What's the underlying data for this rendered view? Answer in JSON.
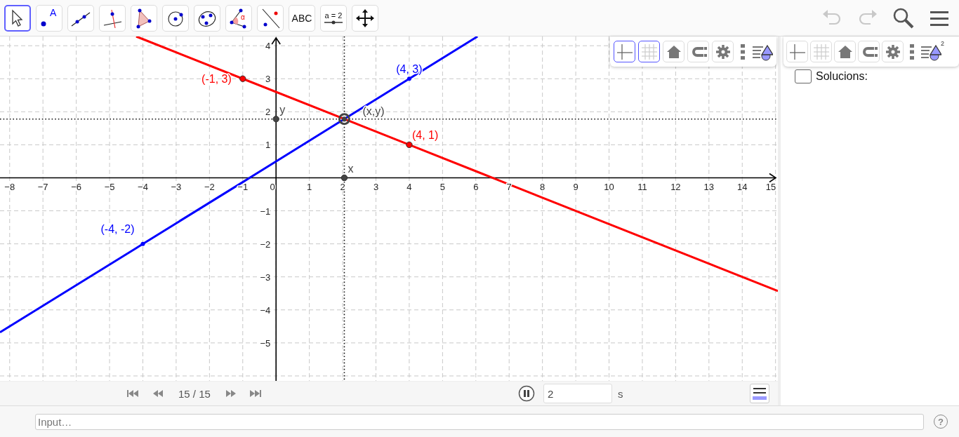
{
  "toolbar": {
    "tools": [
      {
        "kind": "move",
        "selected": true
      },
      {
        "kind": "point",
        "label": "A",
        "selected": false
      },
      {
        "kind": "line",
        "selected": false
      },
      {
        "kind": "perpendicular",
        "selected": false
      },
      {
        "kind": "polygon",
        "selected": false
      },
      {
        "kind": "circle",
        "selected": false
      },
      {
        "kind": "conic",
        "selected": false
      },
      {
        "kind": "angle",
        "label": "α",
        "selected": false
      },
      {
        "kind": "reflect",
        "selected": false
      },
      {
        "kind": "text",
        "label": "ABC",
        "selected": false
      },
      {
        "kind": "slider",
        "label": "a = 2",
        "selected": false
      },
      {
        "kind": "move-view",
        "selected": false
      }
    ],
    "actions": [
      {
        "kind": "undo",
        "disabled": true
      },
      {
        "kind": "redo",
        "disabled": true
      },
      {
        "kind": "search",
        "disabled": false
      },
      {
        "kind": "menu",
        "disabled": false
      }
    ]
  },
  "graphics_view": {
    "style_bar": {
      "buttons": [
        {
          "kind": "axes",
          "selected": true
        },
        {
          "kind": "grid",
          "selected": true
        },
        {
          "kind": "home",
          "selected": false
        },
        {
          "kind": "snap",
          "selected": false
        },
        {
          "kind": "settings",
          "selected": false
        },
        {
          "kind": "more"
        },
        {
          "kind": "view-menu"
        }
      ]
    },
    "chart_data": {
      "type": "line",
      "x": [
        -8.29,
        -4.2,
        -4,
        -1,
        4,
        6.05,
        15.07
      ],
      "grid": true,
      "series": [
        {
          "color": "#0000ff",
          "values": [
            -4.68,
            -2.13,
            -2,
            -0.13,
            3,
            4.28,
            null
          ]
        },
        {
          "color": "#ff0000",
          "values": [
            null,
            4.28,
            4.2,
            3,
            1,
            0.18,
            -3.43
          ]
        }
      ],
      "ref_lines": [
        {
          "axis": "x",
          "value": 2.05
        },
        {
          "axis": "y",
          "value": 1.78
        }
      ],
      "xlim": [
        -8.29,
        15.07
      ],
      "ylim": [
        -6.15,
        4.28
      ],
      "xticks": [
        {
          "value": -8,
          "label": "−8"
        },
        {
          "value": -7,
          "label": "−7"
        },
        {
          "value": -6,
          "label": "−6"
        },
        {
          "value": -5,
          "label": "−5"
        },
        {
          "value": -4,
          "label": "−4"
        },
        {
          "value": -3,
          "label": "−3"
        },
        {
          "value": -2,
          "label": "−2"
        },
        {
          "value": -1,
          "label": "−1"
        },
        0,
        1,
        2,
        3,
        4,
        5,
        6,
        7,
        8,
        9,
        10,
        11,
        12,
        13,
        14,
        15
      ],
      "yticks": [
        {
          "value": -5,
          "label": "−5"
        },
        {
          "value": -4,
          "label": "−4"
        },
        {
          "value": -3,
          "label": "−3"
        },
        {
          "value": -2,
          "label": "−2"
        },
        {
          "value": -1,
          "label": "−1"
        },
        1,
        2,
        3,
        4
      ],
      "annotations": [
        {
          "x": -4,
          "y": -2,
          "text": "(-4, -2)"
        },
        {
          "x": 4,
          "y": 3,
          "text": "(4, 3)"
        },
        {
          "x": -1,
          "y": 3,
          "text": "(-1, 3)"
        },
        {
          "x": 4,
          "y": 1,
          "text": "(4, 1)"
        },
        {
          "x": 2.05,
          "y": 1.78,
          "text": "(x,y)"
        },
        {
          "x": 2.05,
          "y": 0,
          "text": "x"
        },
        {
          "x": 0,
          "y": 1.78,
          "text": "y"
        }
      ]
    }
  },
  "playback": {
    "frame": "15 / 15",
    "playing": true,
    "speed": "2",
    "unit": "s"
  },
  "side_view": {
    "style_bar": {
      "buttons": [
        {
          "kind": "axes",
          "selected": false
        },
        {
          "kind": "grid",
          "selected": false
        },
        {
          "kind": "home",
          "selected": false
        },
        {
          "kind": "snap",
          "selected": false
        },
        {
          "kind": "settings",
          "selected": false
        },
        {
          "kind": "more"
        },
        {
          "kind": "view-menu",
          "badge": "2"
        }
      ]
    },
    "checkbox": {
      "label": "Solucions:",
      "checked": false
    }
  },
  "input_bar": {
    "placeholder": "Input…",
    "help": "?"
  }
}
